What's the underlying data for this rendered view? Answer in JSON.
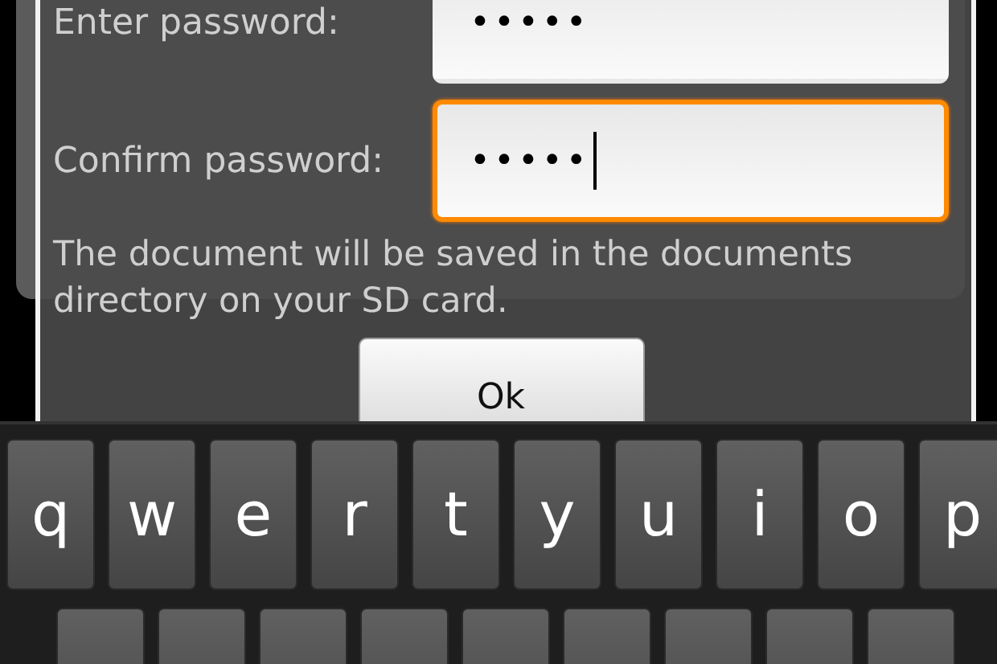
{
  "dialog": {
    "fields": [
      {
        "label": "Enter password:",
        "value": "•••••",
        "focused": false
      },
      {
        "label": "Confirm password:",
        "value": "•••••",
        "focused": true
      }
    ],
    "message": "The document will be saved in the documents directory on your SD card.",
    "button": "Ok"
  },
  "keyboard": {
    "rows": [
      {
        "keys": [
          "q",
          "w",
          "e",
          "r",
          "t",
          "y",
          "u",
          "i",
          "o",
          "p"
        ]
      }
    ]
  }
}
